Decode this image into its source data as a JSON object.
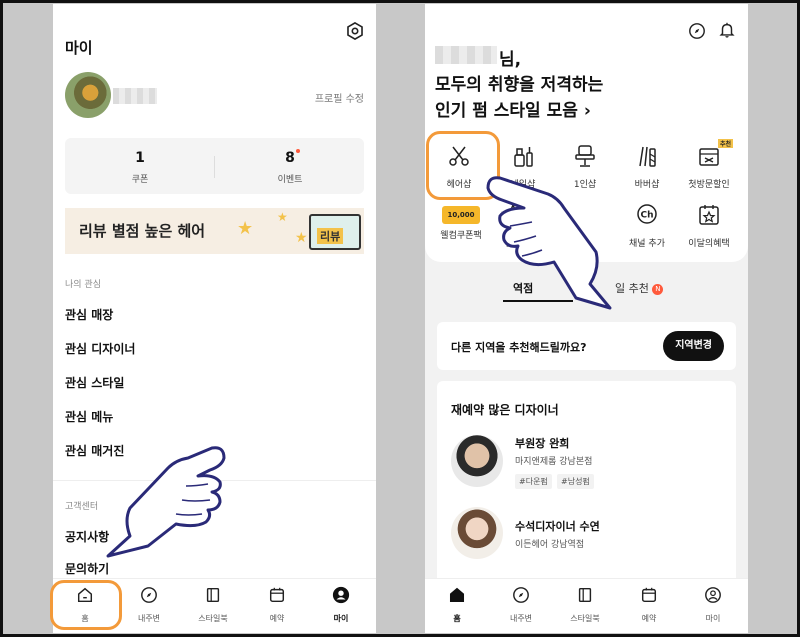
{
  "left_screen": {
    "title": "마이",
    "profile_edit": "프로필 수정",
    "stats": [
      {
        "value": "1",
        "label": "쿠폰"
      },
      {
        "value": "8",
        "label": "이벤트"
      }
    ],
    "banner": {
      "text": "리뷰 별점 높은 헤어",
      "card_text": "리뷰"
    },
    "interest_section": "나의 관심",
    "interest_items": [
      "관심 매장",
      "관심 디자이너",
      "관심 스타일",
      "관심 메뉴",
      "관심 매거진"
    ],
    "support_section": "고객센터",
    "support_items": [
      "공지사항",
      "문의하기"
    ],
    "bottom_nav": [
      {
        "label": "홈",
        "icon": "home-icon"
      },
      {
        "label": "내주변",
        "icon": "compass-icon"
      },
      {
        "label": "스타일북",
        "icon": "book-icon"
      },
      {
        "label": "예약",
        "icon": "calendar-icon"
      },
      {
        "label": "마이",
        "icon": "person-icon",
        "active": true
      }
    ]
  },
  "right_screen": {
    "greeting_suffix": "님,",
    "headline_line1": "모두의 취향을 저격하는",
    "headline_line2": "인기 펌 스타일 모음",
    "headline_arrow": "›",
    "categories_row1": [
      {
        "label": "헤어샵",
        "icon": "scissors-icon"
      },
      {
        "label": "네일샵",
        "icon": "nail-polish-icon"
      },
      {
        "label": "1인샵",
        "icon": "chair-icon"
      },
      {
        "label": "바버샵",
        "icon": "barber-icon"
      },
      {
        "label": "첫방문할인",
        "icon": "gift-icon",
        "badge": "추천"
      }
    ],
    "categories_row2": [
      {
        "label": "웰컴쿠폰팩",
        "icon": "coupon-icon",
        "icon_text": "10,000"
      },
      {
        "label": "별점",
        "icon": "star-icon"
      },
      {
        "label": "",
        "icon": "blank-icon"
      },
      {
        "label": "채널 추가",
        "icon": "channel-icon",
        "icon_text": "Ch"
      },
      {
        "label": "이달의혜택",
        "icon": "calendar-star-icon"
      }
    ],
    "tabs": [
      {
        "label": "역점"
      },
      {
        "label": "일 추천",
        "badge": "N"
      }
    ],
    "region_prompt": "다른 지역을 추천해드릴까요?",
    "region_button": "지역변경",
    "designer_section_title": "재예약 많은 디자이너",
    "designers": [
      {
        "name": "부원장 완희",
        "shop": "마지앤제롬 강남본점",
        "tags": [
          "#다운펌",
          "#남성펌"
        ]
      },
      {
        "name": "수석디자이너 수연",
        "shop": "이든헤어 강남역점",
        "tags": []
      }
    ],
    "bottom_nav": [
      {
        "label": "홈",
        "icon": "home-icon",
        "active": true
      },
      {
        "label": "내주변",
        "icon": "compass-icon"
      },
      {
        "label": "스타일북",
        "icon": "book-icon"
      },
      {
        "label": "예약",
        "icon": "calendar-icon"
      },
      {
        "label": "마이",
        "icon": "person-icon"
      }
    ]
  },
  "colors": {
    "highlight": "#f39a3a",
    "accent_yellow": "#f3c24a",
    "badge_red": "#ff5a3c",
    "background": "#c8c8c8"
  }
}
